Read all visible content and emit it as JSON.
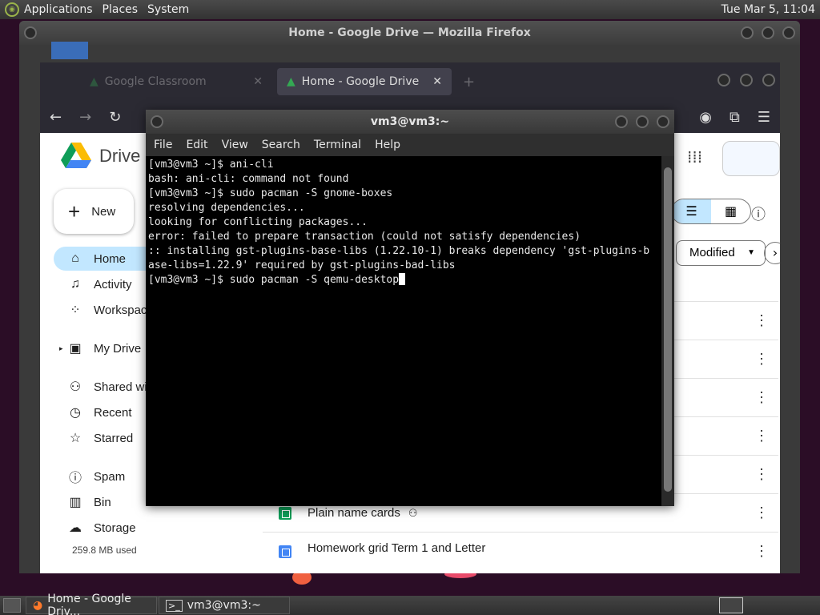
{
  "top_panel": {
    "menus": [
      "Applications",
      "Places",
      "System"
    ],
    "clock": "Tue Mar 5, 11:04"
  },
  "firefox": {
    "window_title": "Home - Google Drive — Mozilla Firefox",
    "tabs": [
      {
        "label": "Google Classroom"
      },
      {
        "label": "Home - Google Drive",
        "close": "✕"
      }
    ],
    "new_tab": "+"
  },
  "drive": {
    "logo_text": "Drive",
    "new_button": "New",
    "sidebar": [
      {
        "label": "Home",
        "icon": "home-icon",
        "glyph": "⌂"
      },
      {
        "label": "Activity",
        "icon": "bell-icon",
        "glyph": "🔔"
      },
      {
        "label": "Workspac",
        "icon": "workspaces-icon",
        "glyph": "⁘"
      },
      {
        "label": "My Drive",
        "icon": "my-drive-icon",
        "glyph": "▣"
      },
      {
        "label": "Shared wi",
        "icon": "shared-icon",
        "glyph": "👥"
      },
      {
        "label": "Recent",
        "icon": "clock-icon",
        "glyph": "◷"
      },
      {
        "label": "Starred",
        "icon": "star-icon",
        "glyph": "☆"
      },
      {
        "label": "Spam",
        "icon": "spam-icon",
        "glyph": "ⓘ"
      },
      {
        "label": "Bin",
        "icon": "bin-icon",
        "glyph": "🗑"
      },
      {
        "label": "Storage",
        "icon": "cloud-icon",
        "glyph": "☁"
      }
    ],
    "storage_used": "259.8 MB used",
    "filter_modified": "Modified",
    "files": [
      {
        "name": ""
      },
      {
        "name": ""
      },
      {
        "name": ""
      },
      {
        "name": ""
      },
      {
        "name": ""
      },
      {
        "name": "Plain name cards"
      },
      {
        "name": "Homework grid Term 1 and Letter"
      }
    ]
  },
  "terminal": {
    "title": "vm3@vm3:~",
    "menu": [
      "File",
      "Edit",
      "View",
      "Search",
      "Terminal",
      "Help"
    ],
    "lines": [
      "[vm3@vm3 ~]$ ani-cli",
      "bash: ani-cli: command not found",
      "[vm3@vm3 ~]$ sudo pacman -S gnome-boxes",
      "resolving dependencies...",
      "looking for conflicting packages...",
      "error: failed to prepare transaction (could not satisfy dependencies)",
      ":: installing gst-plugins-base-libs (1.22.10-1) breaks dependency 'gst-plugins-b",
      "ase-libs=1.22.9' required by gst-plugins-bad-libs",
      "[vm3@vm3 ~]$ sudo pacman -S qemu-desktop"
    ]
  },
  "taskbar": {
    "items": [
      {
        "label": "Home - Google Driv...",
        "icon": "firefox-icon"
      },
      {
        "label": "vm3@vm3:~",
        "icon": "terminal-icon"
      }
    ]
  }
}
